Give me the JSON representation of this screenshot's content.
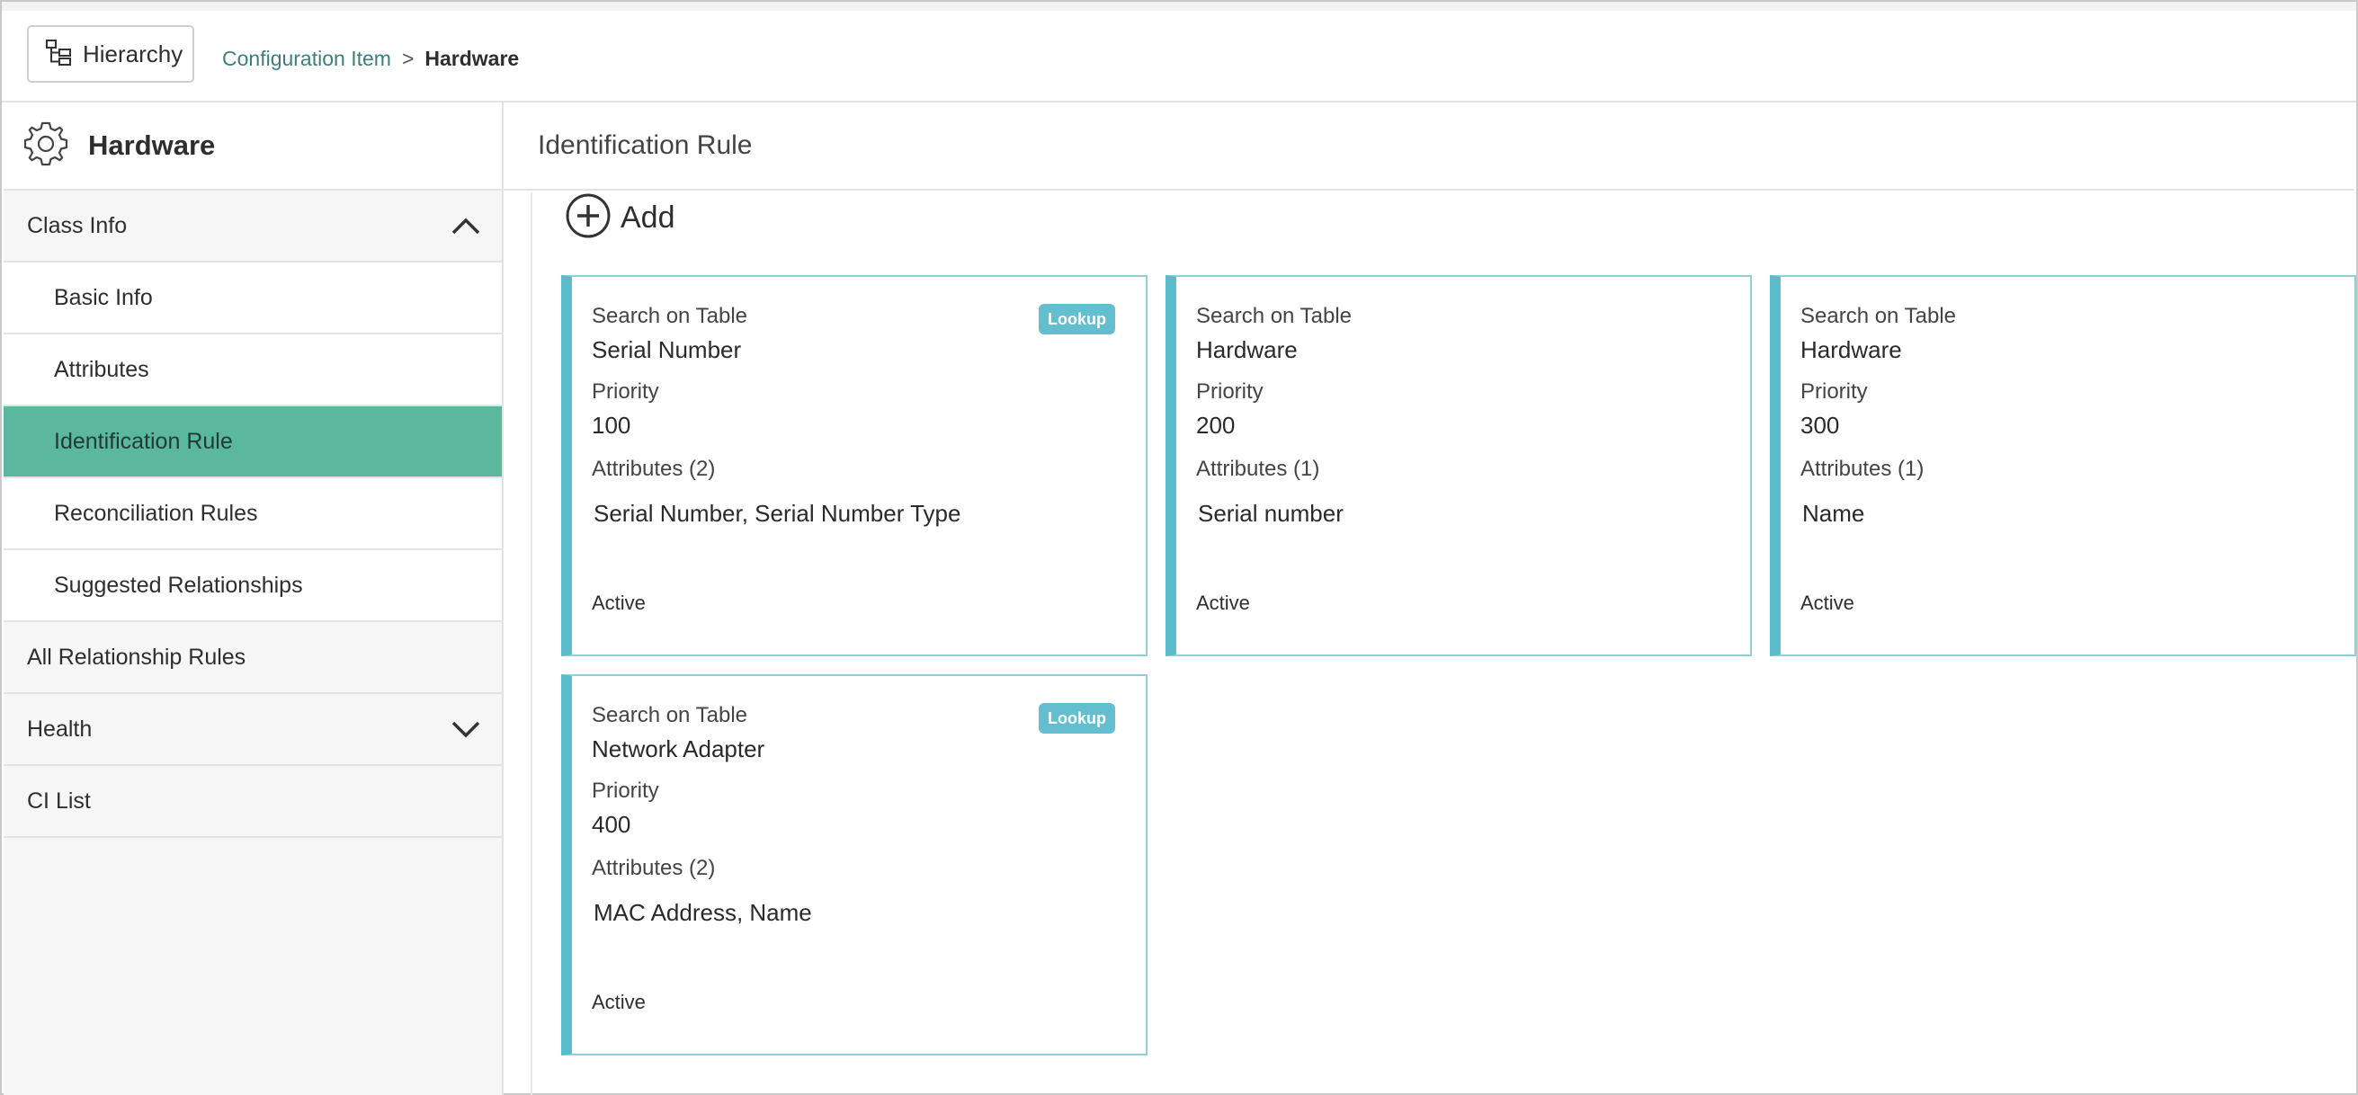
{
  "topbar": {
    "hierarchy_label": "Hierarchy",
    "breadcrumb": {
      "parent": "Configuration Item",
      "separator": ">",
      "current": "Hardware"
    }
  },
  "sidebar": {
    "title": "Hardware",
    "items": [
      {
        "label": "Class Info"
      },
      {
        "label": "Basic Info"
      },
      {
        "label": "Attributes"
      },
      {
        "label": "Identification Rule"
      },
      {
        "label": "Reconciliation Rules"
      },
      {
        "label": "Suggested Relationships"
      },
      {
        "label": "All Relationship Rules"
      },
      {
        "label": "Health"
      },
      {
        "label": "CI List"
      }
    ]
  },
  "main": {
    "title": "Identification Rule",
    "add_label": "Add",
    "cards": [
      {
        "table_label": "Search on Table",
        "table": "Serial Number",
        "badge": "Lookup",
        "priority_label": "Priority",
        "priority": "100",
        "attributes_label": "Attributes (2)",
        "attributes": "Serial Number, Serial Number Type",
        "status": "Active"
      },
      {
        "table_label": "Search on Table",
        "table": "Hardware",
        "priority_label": "Priority",
        "priority": "200",
        "attributes_label": "Attributes (1)",
        "attributes": "Serial number",
        "status": "Active"
      },
      {
        "table_label": "Search on Table",
        "table": "Hardware",
        "priority_label": "Priority",
        "priority": "300",
        "attributes_label": "Attributes (1)",
        "attributes": "Name",
        "status": "Active"
      },
      {
        "table_label": "Search on Table",
        "table": "Network Adapter",
        "badge": "Lookup",
        "priority_label": "Priority",
        "priority": "400",
        "attributes_label": "Attributes (2)",
        "attributes": "MAC Address, Name",
        "status": "Active"
      }
    ]
  },
  "colors": {
    "active_nav": "#5bb79e",
    "card_accent": "#5bbcca",
    "badge": "#63bfd0",
    "link": "#3c7f7a"
  }
}
